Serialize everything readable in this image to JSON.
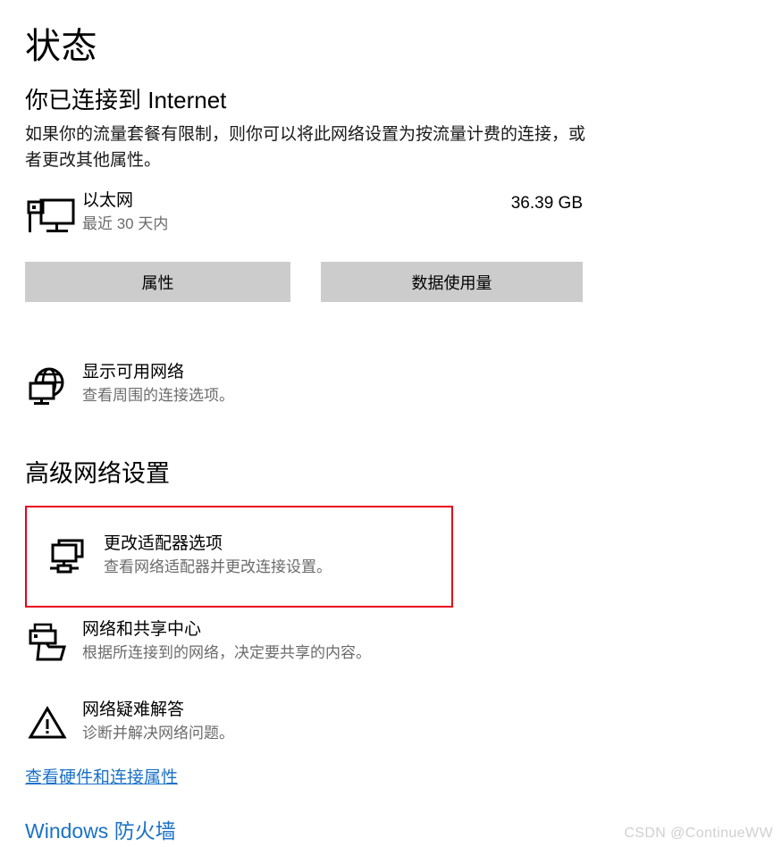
{
  "page": {
    "title": "状态",
    "status_heading": "你已连接到 Internet",
    "status_description": "如果你的流量套餐有限制，则你可以将此网络设置为按流量计费的连接，或者更改其他属性。"
  },
  "connection": {
    "icon": "ethernet-monitor-icon",
    "name": "以太网",
    "period": "最近 30 天内",
    "usage": "36.39 GB"
  },
  "buttons": {
    "properties": "属性",
    "data_usage": "数据使用量"
  },
  "show_networks": {
    "icon": "globe-monitor-icon",
    "title": "显示可用网络",
    "subtitle": "查看周围的连接选项。"
  },
  "advanced": {
    "section_title": "高级网络设置",
    "items": [
      {
        "icon": "network-adapter-icon",
        "title": "更改适配器选项",
        "subtitle": "查看网络适配器并更改连接设置。",
        "highlighted": true
      },
      {
        "icon": "printer-folder-sharing-icon",
        "title": "网络和共享中心",
        "subtitle": "根据所连接到的网络，决定要共享的内容。",
        "highlighted": false
      },
      {
        "icon": "warning-triangle-icon",
        "title": "网络疑难解答",
        "subtitle": "诊断并解决网络问题。",
        "highlighted": false
      }
    ]
  },
  "links": {
    "hardware_properties": "查看硬件和连接属性",
    "firewall": "Windows 防火墙"
  },
  "watermark": "CSDN @ContinueWW",
  "colors": {
    "highlight_border": "#e8001c",
    "link": "#1a72c8",
    "button_bg": "#cccccc",
    "subtext": "#6b6b6b"
  }
}
